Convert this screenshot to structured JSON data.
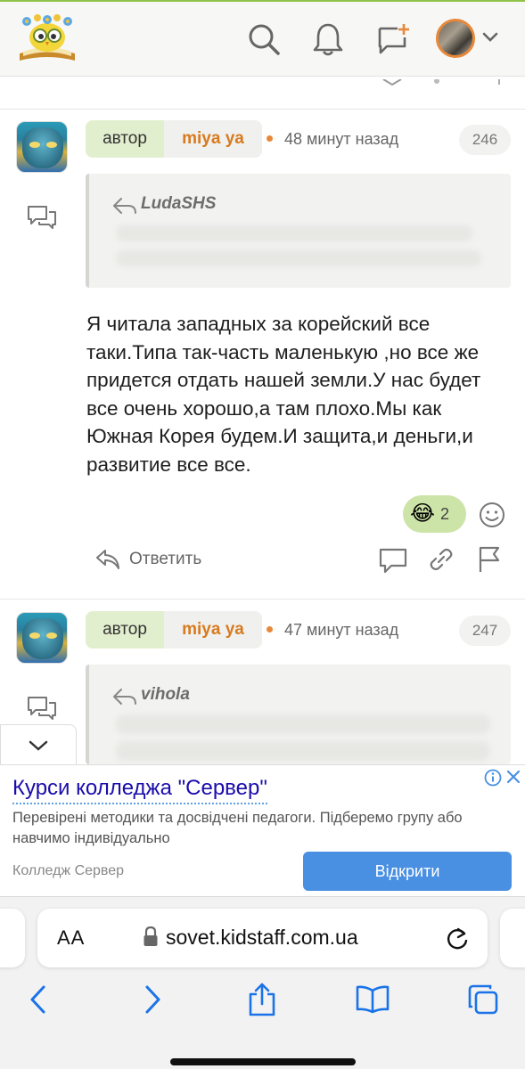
{
  "header": {
    "logo": "kidstaff-owl-logo",
    "icons": [
      "search-icon",
      "bell-icon",
      "new-message-icon",
      "chevron-down-icon"
    ]
  },
  "posts": [
    {
      "badge_label": "автор",
      "author": "miya ya",
      "time": "48 минут назад",
      "number": "246",
      "quote_author": "LudaSHS",
      "text_lines": [
        "Я читала западных за корейский все",
        "таки.Типа так-часть маленькую ,но все же",
        "придется отдать нашей земли.У нас будет",
        "все очень хорошо,а там плохо.Мы как",
        "Южная Корея будем.И защита,и деньги,и",
        "развитие все все."
      ],
      "reaction_emoji": "😂",
      "reaction_count": "2",
      "reply_label": "Ответить"
    },
    {
      "badge_label": "автор",
      "author": "miya ya",
      "time": "47 минут назад",
      "number": "247",
      "quote_author": "vihola"
    }
  ],
  "ad": {
    "title": "Курси колледжа \"Сервер\"",
    "description": "Перевірені методики та досвідчені педагоги. Підберемо групу або навчимо індивідуально",
    "advertiser": "Колледж Сервер",
    "cta": "Відкрити",
    "accent": "#4a90e2"
  },
  "safari": {
    "aa_label": "AA",
    "url": "sovet.kidstaff.com.ua",
    "toolbar_icons": [
      "back-icon",
      "forward-icon",
      "share-icon",
      "bookmarks-icon",
      "tabs-icon"
    ]
  },
  "colors": {
    "brand_green": "#8fc34a",
    "author_orange": "#d87a1e",
    "ios_blue": "#1a73e8"
  }
}
